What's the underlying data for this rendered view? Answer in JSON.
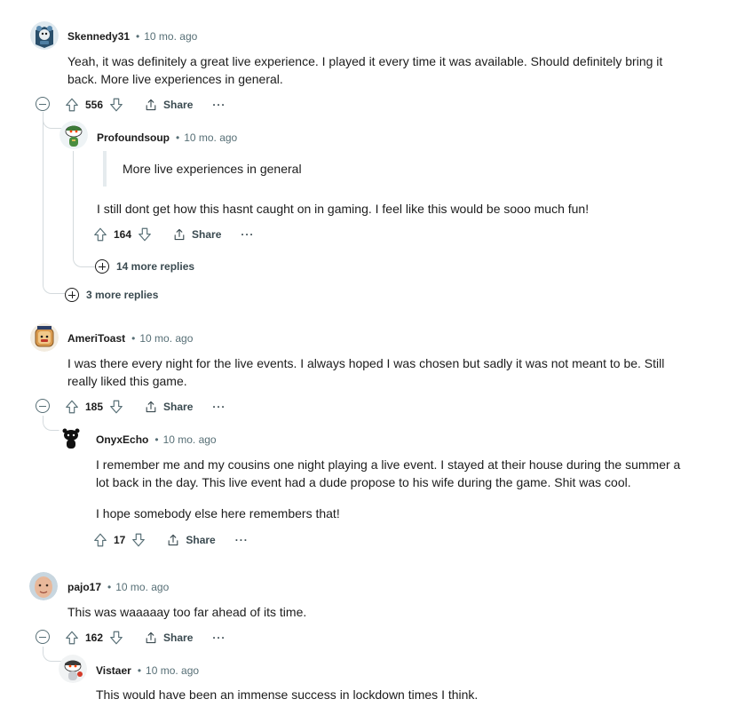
{
  "comments": [
    {
      "username": "Skennedy31",
      "time": "10 mo. ago",
      "body": [
        "Yeah, it was definitely a great live experience. I played it every time it was available. Should definitely bring it back. More live experiences in general."
      ],
      "votes": "556",
      "share_label": "Share",
      "more_label": "···",
      "more_replies_label": "3 more replies",
      "reply": {
        "username": "Profoundsoup",
        "time": "10 mo. ago",
        "quote": "More live experiences in general",
        "body": [
          "I still dont get how this hasnt caught on in gaming. I feel like this would be sooo much fun!"
        ],
        "votes": "164",
        "share_label": "Share",
        "more_label": "···",
        "more_replies_label": "14 more replies"
      }
    },
    {
      "username": "AmeriToast",
      "time": "10 mo. ago",
      "body": [
        "I was there every night for the live events. I always hoped I was chosen but sadly it was not meant to be. Still really liked this game."
      ],
      "votes": "185",
      "share_label": "Share",
      "more_label": "···",
      "reply": {
        "username": "OnyxEcho",
        "time": "10 mo. ago",
        "body": [
          "I remember me and my cousins one night playing a live event. I stayed at their house during the summer a lot back in the day. This live event had a dude propose to his wife during the game. Shit was cool.",
          "I hope somebody else here remembers that!"
        ],
        "votes": "17",
        "share_label": "Share",
        "more_label": "···"
      }
    },
    {
      "username": "pajo17",
      "time": "10 mo. ago",
      "body": [
        "This was waaaaay too far ahead of its time."
      ],
      "votes": "162",
      "share_label": "Share",
      "more_label": "···",
      "reply": {
        "username": "Vistaer",
        "time": "10 mo. ago",
        "body": [
          "This would have been an immense success in lockdown times I think."
        ]
      }
    }
  ],
  "icons": {
    "upvote": "upvote-arrow-icon",
    "downvote": "downvote-arrow-icon",
    "share": "share-icon",
    "collapse": "collapse-thread-icon",
    "expand": "expand-replies-icon"
  },
  "colors": {
    "text": "#1c1c1c",
    "meta": "#576f76",
    "thread_line": "#d4dadd",
    "quote_bar": "#e5ebee"
  }
}
